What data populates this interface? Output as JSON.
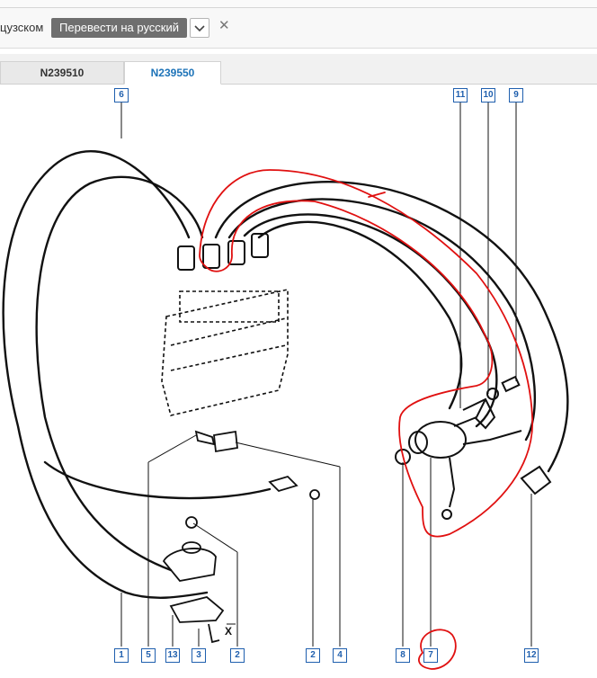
{
  "translate_bar": {
    "language_label": "цузском",
    "translate_button": "Перевести на русский",
    "dropdown_glyph": "⌄",
    "close_glyph": "✕"
  },
  "tabs": [
    {
      "label": "N239510",
      "active": false
    },
    {
      "label": "N239550",
      "active": true
    }
  ],
  "diagram": {
    "callouts": [
      "6",
      "11",
      "10",
      "9",
      "1",
      "5",
      "13",
      "3",
      "2",
      "2",
      "4",
      "8",
      "7",
      "12"
    ],
    "dimension_label": "X",
    "annotation_color": "#e01010",
    "callout_color": "#1f5fae"
  }
}
